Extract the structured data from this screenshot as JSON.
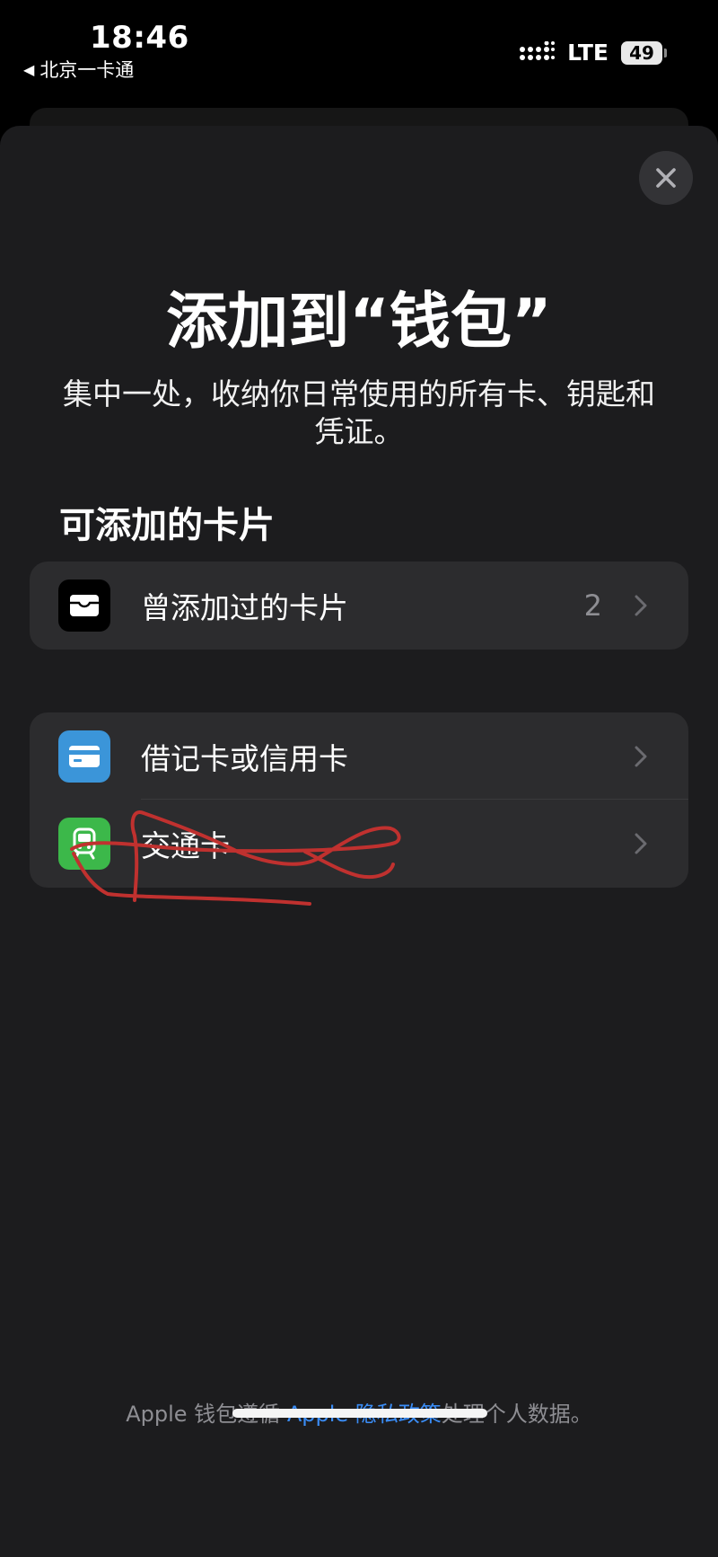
{
  "status_bar": {
    "time": "18:46",
    "back_app": "北京一卡通",
    "network": "LTE",
    "battery": "49"
  },
  "sheet": {
    "title": "添加到“钱包”",
    "subtitle": "集中一处，收纳你日常使用的所有卡、钥匙和凭证。",
    "section_header": "可添加的卡片",
    "previous_cards": {
      "label": "曾添加过的卡片",
      "count": "2",
      "icon": "wallet-icon"
    },
    "add_options": [
      {
        "label": "借记卡或信用卡",
        "icon": "credit-card-icon",
        "icon_color": "#3b95d9"
      },
      {
        "label": "交通卡",
        "icon": "train-icon",
        "icon_color": "#3cb84a"
      }
    ],
    "footer": {
      "prefix": "Apple 钱包遵循 ",
      "link": "Apple 隐私政策",
      "suffix": "处理个人数据。"
    }
  },
  "colors": {
    "background": "#000000",
    "sheet": "#1c1c1e",
    "row": "#2c2c2e",
    "link": "#3a8cf5",
    "annotation": "#c0312f"
  }
}
